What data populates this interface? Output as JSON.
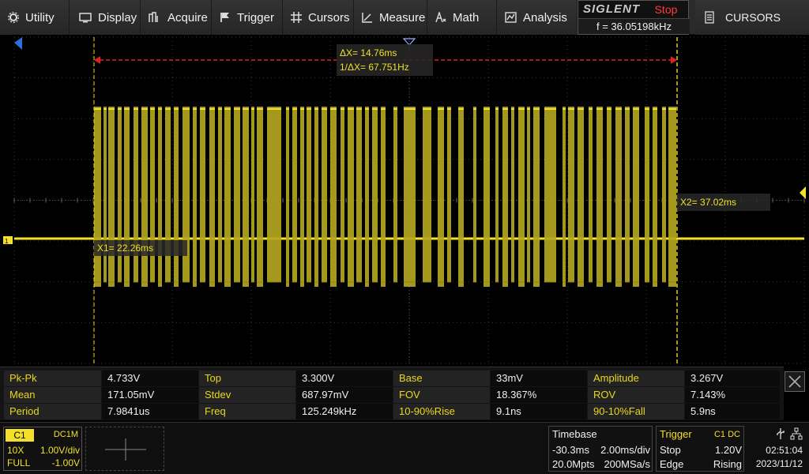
{
  "menu": {
    "utility": "Utility",
    "display": "Display",
    "acquire": "Acquire",
    "trigger": "Trigger",
    "cursors": "Cursors",
    "measure": "Measure",
    "math": "Math",
    "analysis": "Analysis"
  },
  "brand": {
    "logo": "SIGLENT",
    "run_state": "Stop",
    "trigger_frequency": "f = 36.05198kHz"
  },
  "side_panel": {
    "label": "CURSORS"
  },
  "cursors": {
    "delta_x": "ΔX= 14.76ms",
    "inverse_delta_x": "1/ΔX= 67.751Hz",
    "x1": "X1= 22.26ms",
    "x2": "X2= 37.02ms"
  },
  "measurements": [
    [
      {
        "label": "Pk-Pk",
        "value": "4.733V"
      },
      {
        "label": "Top",
        "value": "3.300V"
      },
      {
        "label": "Base",
        "value": "33mV"
      },
      {
        "label": "Amplitude",
        "value": "3.267V"
      }
    ],
    [
      {
        "label": "Mean",
        "value": "171.05mV"
      },
      {
        "label": "Stdev",
        "value": "687.97mV"
      },
      {
        "label": "FOV",
        "value": "18.367%"
      },
      {
        "label": "ROV",
        "value": "7.143%"
      }
    ],
    [
      {
        "label": "Period",
        "value": "7.9841us"
      },
      {
        "label": "Freq",
        "value": "125.249kHz"
      },
      {
        "label": "10-90%Rise",
        "value": "9.1ns"
      },
      {
        "label": "90-10%Fall",
        "value": "5.9ns"
      }
    ]
  ],
  "channel1": {
    "tag": "C1",
    "coupling": "DC1M",
    "probe": "10X",
    "scale": "1.00V/div",
    "bandwidth": "FULL",
    "offset": "-1.00V"
  },
  "timebase": {
    "title": "Timebase",
    "delay": "-30.3ms",
    "scale": "2.00ms/div",
    "memory": "20.0Mpts",
    "sample_rate": "200MSa/s"
  },
  "trigger": {
    "title": "Trigger",
    "source": "C1 DC",
    "mode": "Stop",
    "level": "1.20V",
    "type": "Edge",
    "slope": "Rising"
  },
  "clock": {
    "time": "02:51:04",
    "date": "2023/11/12"
  },
  "colors": {
    "trace": "#b3a620",
    "trace_bright": "#f2e02a",
    "cursor_delta": "#e0201e",
    "grid": "#3a3a3a",
    "run_state": "#ff3b3b",
    "marker_blue": "#2b6fd8"
  }
}
